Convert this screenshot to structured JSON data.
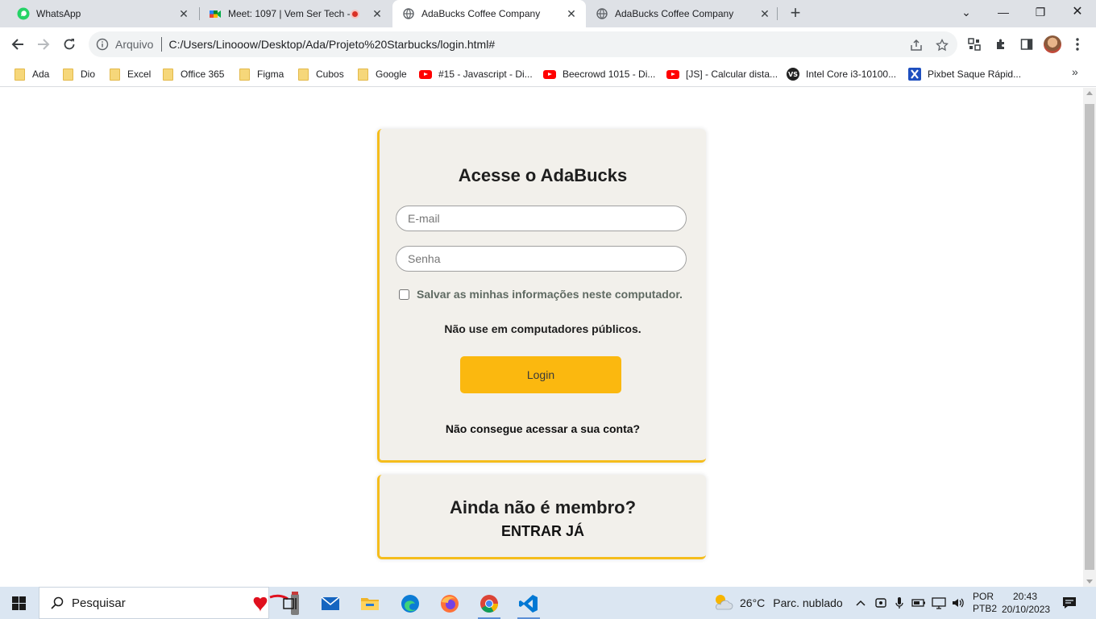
{
  "browser": {
    "tabs": [
      {
        "title": "WhatsApp",
        "icon": "whatsapp-icon",
        "active": false
      },
      {
        "title": "Meet: 1097 | Vem Ser Tech -",
        "icon": "google-meet-icon",
        "active": false,
        "recording": true
      },
      {
        "title": "AdaBucks Coffee Company",
        "icon": "globe-icon",
        "active": true
      },
      {
        "title": "AdaBucks Coffee Company",
        "icon": "globe-icon",
        "active": false
      }
    ],
    "address": {
      "scheme_label": "Arquivo",
      "url": "C:/Users/Linooow/Desktop/Ada/Projeto%20Starbucks/login.html#"
    },
    "bookmarks": [
      {
        "label": "Ada",
        "icon": "folder-icon"
      },
      {
        "label": "Dio",
        "icon": "folder-icon"
      },
      {
        "label": "Excel",
        "icon": "folder-icon"
      },
      {
        "label": "Office 365",
        "icon": "folder-icon"
      },
      {
        "label": "Figma",
        "icon": "folder-icon"
      },
      {
        "label": "Cubos",
        "icon": "folder-icon"
      },
      {
        "label": "Google",
        "icon": "folder-icon"
      },
      {
        "label": "#15 - Javascript - Di...",
        "icon": "youtube-icon"
      },
      {
        "label": "Beecrowd 1015 - Di...",
        "icon": "youtube-icon"
      },
      {
        "label": "[JS] - Calcular dista...",
        "icon": "youtube-icon"
      },
      {
        "label": "Intel Core i3-10100...",
        "icon": "versus-icon"
      },
      {
        "label": "Pixbet Saque Rápid...",
        "icon": "x-brand-icon"
      }
    ]
  },
  "page": {
    "login": {
      "title": "Acesse o AdaBucks",
      "email_placeholder": "E-mail",
      "password_placeholder": "Senha",
      "remember_label": "Salvar as minhas informações neste computador.",
      "warning": "Não use em computadores públicos.",
      "button_label": "Login",
      "forgot_link": "Não consegue acessar a sua conta?"
    },
    "member": {
      "title": "Ainda não é membro?",
      "join_link": "ENTRAR JÁ"
    },
    "colors": {
      "accent": "#fbb80f",
      "card_border": "#f5bd1c",
      "card_bg": "#f2f0eb"
    }
  },
  "taskbar": {
    "search_placeholder": "Pesquisar",
    "apps": [
      "task-view-icon",
      "mail-icon",
      "file-explorer-icon",
      "edge-icon",
      "firefox-icon",
      "chrome-icon",
      "vscode-icon"
    ],
    "weather": {
      "temp": "26°C",
      "condition": "Parc. nublado"
    },
    "language": {
      "line1": "POR",
      "line2": "PTB2"
    },
    "clock": {
      "time": "20:43",
      "date": "20/10/2023"
    }
  }
}
